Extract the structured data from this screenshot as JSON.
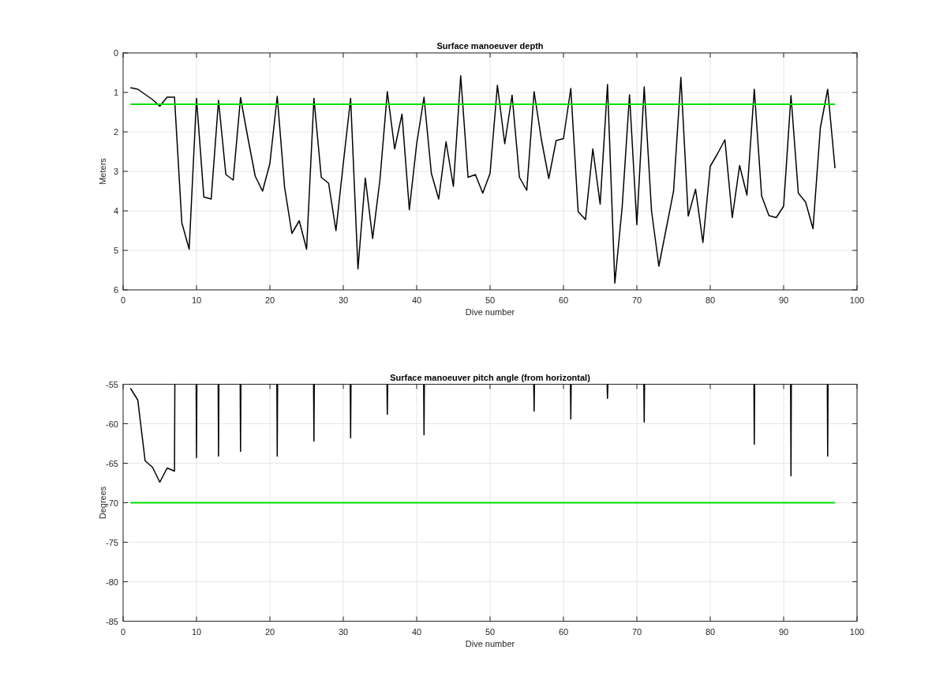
{
  "figure": {
    "charts": [
      {
        "chart_data": {
          "type": "line",
          "grid": true,
          "title": "Surface manoeuver depth",
          "xlabel": "Dive number",
          "ylabel": "Meters",
          "xlim": [
            0,
            100
          ],
          "ylim": [
            6,
            0
          ],
          "xticks": [
            0,
            10,
            20,
            30,
            40,
            50,
            60,
            70,
            80,
            90,
            100
          ],
          "yticks": [
            0,
            1,
            2,
            3,
            4,
            5,
            6
          ],
          "x": [
            1,
            2,
            3,
            4,
            5,
            6,
            7,
            8,
            9,
            10,
            11,
            12,
            13,
            14,
            15,
            16,
            17,
            18,
            19,
            20,
            21,
            22,
            23,
            24,
            25,
            26,
            27,
            28,
            29,
            30,
            31,
            32,
            33,
            34,
            35,
            36,
            37,
            38,
            39,
            40,
            41,
            42,
            43,
            44,
            45,
            46,
            47,
            48,
            49,
            50,
            51,
            52,
            53,
            54,
            55,
            56,
            57,
            58,
            59,
            60,
            61,
            62,
            63,
            64,
            65,
            66,
            67,
            68,
            69,
            70,
            71,
            72,
            73,
            74,
            75,
            76,
            77,
            78,
            79,
            80,
            81,
            82,
            83,
            84,
            85,
            86,
            87,
            88,
            89,
            90,
            91,
            92,
            93,
            94,
            95,
            96,
            97
          ],
          "series": [
            {
              "color": "#000000",
              "values": [
                0.88,
                0.92,
                1.05,
                1.18,
                1.35,
                1.12,
                1.12,
                4.3,
                4.97,
                1.15,
                3.65,
                3.7,
                1.2,
                3.08,
                3.22,
                1.13,
                2.15,
                3.12,
                3.5,
                2.8,
                1.1,
                3.4,
                4.57,
                4.25,
                4.97,
                1.15,
                3.15,
                3.3,
                4.5,
                2.8,
                1.15,
                5.47,
                3.17,
                4.7,
                3.2,
                0.98,
                2.43,
                1.55,
                3.97,
                2.3,
                1.12,
                3.05,
                3.7,
                2.25,
                3.38,
                0.58,
                3.15,
                3.08,
                3.55,
                3.05,
                0.82,
                2.3,
                1.07,
                3.15,
                3.48,
                0.98,
                2.2,
                3.18,
                2.22,
                2.17,
                0.9,
                4.02,
                4.22,
                2.43,
                3.83,
                0.8,
                5.83,
                3.9,
                1.06,
                4.35,
                0.86,
                4.0,
                5.4,
                4.45,
                3.5,
                0.62,
                4.13,
                3.45,
                4.8,
                2.87,
                2.55,
                2.2,
                4.17,
                2.85,
                3.6,
                0.92,
                3.62,
                4.12,
                4.17,
                3.88,
                1.08,
                3.55,
                3.78,
                4.45,
                1.9,
                0.92,
                2.92
              ]
            },
            {
              "color": "#00e000",
              "values": [
                1.3,
                1.3,
                1.3,
                1.3,
                1.3,
                1.3,
                1.3,
                1.3,
                1.3,
                1.3,
                1.3,
                1.3,
                1.3,
                1.3,
                1.3,
                1.3,
                1.3,
                1.3,
                1.3,
                1.3,
                1.3,
                1.3,
                1.3,
                1.3,
                1.3,
                1.3,
                1.3,
                1.3,
                1.3,
                1.3,
                1.3,
                1.3,
                1.3,
                1.3,
                1.3,
                1.3,
                1.3,
                1.3,
                1.3,
                1.3,
                1.3,
                1.3,
                1.3,
                1.3,
                1.3,
                1.3,
                1.3,
                1.3,
                1.3,
                1.3,
                1.3,
                1.3,
                1.3,
                1.3,
                1.3,
                1.3,
                1.3,
                1.3,
                1.3,
                1.3,
                1.3,
                1.3,
                1.3,
                1.3,
                1.3,
                1.3,
                1.3,
                1.3,
                1.3,
                1.3,
                1.3,
                1.3,
                1.3,
                1.3,
                1.3,
                1.3,
                1.3,
                1.3,
                1.3,
                1.3,
                1.3,
                1.3,
                1.3,
                1.3,
                1.3,
                1.3,
                1.3,
                1.3,
                1.3,
                1.3,
                1.3,
                1.3,
                1.3,
                1.3,
                1.3,
                1.3,
                1.3
              ]
            }
          ]
        }
      },
      {
        "chart_data": {
          "type": "line",
          "grid": true,
          "title": "Surface manoeuver pitch angle (from horizontal)",
          "xlabel": "Dive number",
          "ylabel": "Degrees",
          "xlim": [
            0,
            100
          ],
          "ylim": [
            -85,
            -55
          ],
          "xticks": [
            0,
            10,
            20,
            30,
            40,
            50,
            60,
            70,
            80,
            90,
            100
          ],
          "yticks": [
            -85,
            -80,
            -75,
            -70,
            -65,
            -60,
            -55
          ],
          "x": [
            1,
            2,
            3,
            4,
            5,
            6,
            7,
            7.05,
            8.5,
            9.95,
            10,
            10.05,
            11.5,
            12.95,
            13,
            13.05,
            14.5,
            15.95,
            16,
            16.05,
            18.5,
            20.95,
            21,
            21.05,
            23.5,
            25.95,
            26,
            26.05,
            28.5,
            30.95,
            31,
            31.05,
            33.5,
            35.95,
            36,
            36.05,
            38.5,
            40.95,
            41,
            41.05,
            48.5,
            55.95,
            56,
            56.05,
            58.5,
            60.95,
            61,
            61.05,
            63.5,
            65.95,
            66,
            66.05,
            68.5,
            70.95,
            71,
            71.05,
            78.5,
            85.95,
            86,
            86.05,
            88.5,
            90.95,
            91,
            91.05,
            93.5,
            95.95,
            96,
            96.05,
            97
          ],
          "series": [
            {
              "color": "#000000",
              "values": [
                -55.5,
                -57,
                -64.7,
                -65.5,
                -67.4,
                -65.6,
                -66,
                -55,
                null,
                -55,
                -64.3,
                -55,
                null,
                -55,
                -64.1,
                -55,
                null,
                -55,
                -63.5,
                -55,
                null,
                -55,
                -64.1,
                -55,
                null,
                -55,
                -62.2,
                -55,
                null,
                -55,
                -61.8,
                -55,
                null,
                -55,
                -58.8,
                -55,
                null,
                -55,
                -61.4,
                -55,
                null,
                -55,
                -58.4,
                -55,
                null,
                -55,
                -59.4,
                -55,
                null,
                -55,
                -56.8,
                -55,
                null,
                -55,
                -59.8,
                -55,
                null,
                -55,
                -62.6,
                -55,
                null,
                -55,
                -66.6,
                -55,
                null,
                -55,
                -64.1,
                -55,
                null
              ]
            },
            {
              "color": "#00e000",
              "values": [
                -70,
                -70,
                -70,
                -70,
                -70,
                -70,
                -70,
                -70,
                -70,
                -70,
                -70,
                -70,
                -70,
                -70,
                -70,
                -70,
                -70,
                -70,
                -70,
                -70,
                -70,
                -70,
                -70,
                -70,
                -70,
                -70,
                -70,
                -70,
                -70,
                -70,
                -70,
                -70,
                -70,
                -70,
                -70,
                -70,
                -70,
                -70,
                -70,
                -70,
                -70,
                -70,
                -70,
                -70,
                -70,
                -70,
                -70,
                -70,
                -70,
                -70,
                -70,
                -70,
                -70,
                -70,
                -70,
                -70,
                -70,
                -70,
                -70,
                -70,
                -70,
                -70,
                -70,
                -70,
                -70,
                -70,
                -70,
                -70,
                -70
              ]
            }
          ]
        }
      }
    ]
  }
}
